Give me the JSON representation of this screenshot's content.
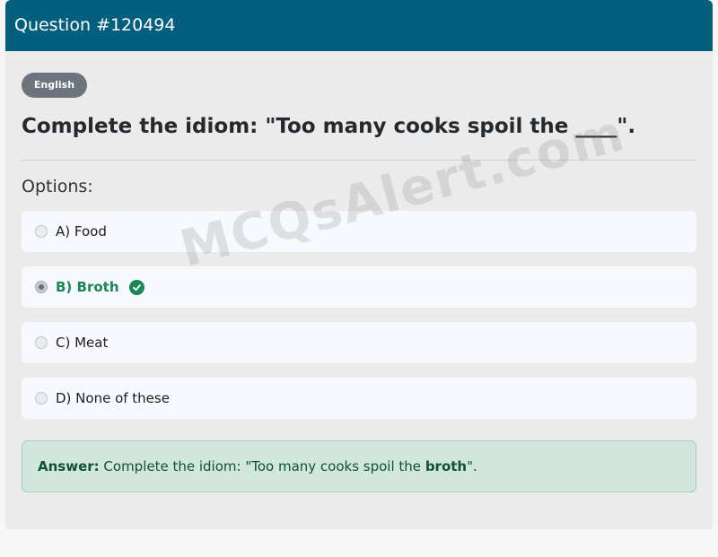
{
  "header": {
    "title": "Question #120494"
  },
  "badge": "English",
  "question": "Complete the idiom: \"Too many cooks spoil the ____\".",
  "options_label": "Options:",
  "options": [
    {
      "label": "A) Food",
      "selected": false,
      "correct": false
    },
    {
      "label": "B) Broth",
      "selected": true,
      "correct": true
    },
    {
      "label": "C) Meat",
      "selected": false,
      "correct": false
    },
    {
      "label": "D) None of these",
      "selected": false,
      "correct": false
    }
  ],
  "answer": {
    "prefix": "Answer:",
    "text_before": " Complete the idiom: \"Too many cooks spoil the ",
    "highlight": "broth",
    "text_after": "\"."
  },
  "watermark": "MCQsAlert.com",
  "colors": {
    "header_bg": "#035f7d",
    "correct": "#198754",
    "answer_bg": "#d1e7dd"
  }
}
